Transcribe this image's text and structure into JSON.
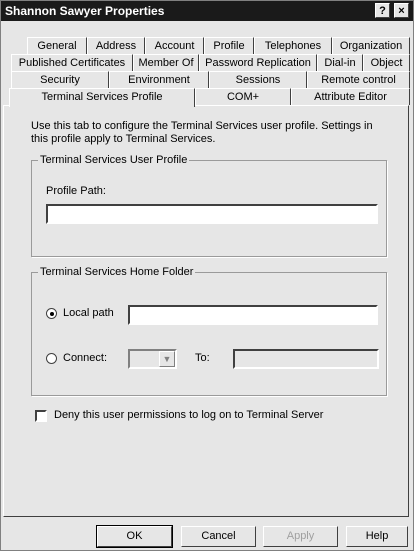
{
  "window": {
    "title": "Shannon Sawyer Properties",
    "help_glyph": "?",
    "close_glyph": "×"
  },
  "tabs": {
    "row1": [
      "General",
      "Address",
      "Account",
      "Profile",
      "Telephones",
      "Organization"
    ],
    "row2": [
      "Published Certificates",
      "Member Of",
      "Password Replication",
      "Dial-in",
      "Object"
    ],
    "row3": [
      "Security",
      "Environment",
      "Sessions",
      "Remote control"
    ],
    "row4": [
      "Terminal Services Profile",
      "COM+",
      "Attribute Editor"
    ],
    "active": "Terminal Services Profile"
  },
  "content": {
    "intro": "Use this tab to configure the Terminal Services user profile. Settings in this profile apply to Terminal Services.",
    "profile_group": {
      "legend": "Terminal Services User Profile",
      "path_label": "Profile Path:",
      "path_value": ""
    },
    "home_group": {
      "legend": "Terminal Services Home Folder",
      "local_label": "Local path",
      "local_value": "",
      "connect_label": "Connect:",
      "to_label": "To:",
      "drive_value": "",
      "to_value": "",
      "selected": "local"
    },
    "deny_label": "Deny this user permissions to log on to Terminal Server",
    "deny_checked": false
  },
  "buttons": {
    "ok": "OK",
    "cancel": "Cancel",
    "apply": "Apply",
    "help": "Help"
  },
  "icons": {
    "dropdown": "chevron-down-icon"
  }
}
